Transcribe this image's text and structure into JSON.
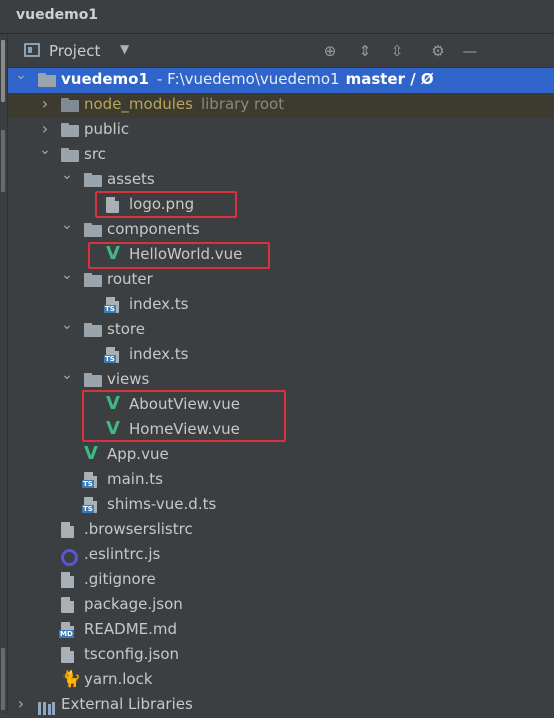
{
  "window": {
    "title": "vuedemo1"
  },
  "header": {
    "label": "Project"
  },
  "tree": [
    {
      "id": "root",
      "label": "vuedemo1",
      "sub": "- F:\\vuedemo\\vuedemo1",
      "vcs": "master / Ø",
      "kind": "folder",
      "arrow": "down",
      "depth": 0,
      "selected": true
    },
    {
      "id": "node-modules",
      "label": "node_modules",
      "sub": "library root",
      "kind": "folder-dim",
      "arrow": "right",
      "depth": 1,
      "excluded": true
    },
    {
      "id": "public",
      "label": "public",
      "kind": "folder",
      "arrow": "right",
      "depth": 1
    },
    {
      "id": "src",
      "label": "src",
      "kind": "folder",
      "arrow": "down",
      "depth": 1
    },
    {
      "id": "assets",
      "label": "assets",
      "kind": "folder",
      "arrow": "down",
      "depth": 2
    },
    {
      "id": "logo-png",
      "label": "logo.png",
      "kind": "image",
      "depth": 3
    },
    {
      "id": "components",
      "label": "components",
      "kind": "folder",
      "arrow": "down",
      "depth": 2
    },
    {
      "id": "helloworld-vue",
      "label": "HelloWorld.vue",
      "kind": "vue",
      "depth": 3
    },
    {
      "id": "router",
      "label": "router",
      "kind": "folder",
      "arrow": "down",
      "depth": 2
    },
    {
      "id": "router-index-ts",
      "label": "index.ts",
      "kind": "ts",
      "depth": 3
    },
    {
      "id": "store",
      "label": "store",
      "kind": "folder",
      "arrow": "down",
      "depth": 2
    },
    {
      "id": "store-index-ts",
      "label": "index.ts",
      "kind": "ts",
      "depth": 3
    },
    {
      "id": "views",
      "label": "views",
      "kind": "folder",
      "arrow": "down",
      "depth": 2
    },
    {
      "id": "aboutview-vue",
      "label": "AboutView.vue",
      "kind": "vue",
      "depth": 3
    },
    {
      "id": "homeview-vue",
      "label": "HomeView.vue",
      "kind": "vue",
      "depth": 3
    },
    {
      "id": "app-vue",
      "label": "App.vue",
      "kind": "vue",
      "depth": 2
    },
    {
      "id": "main-ts",
      "label": "main.ts",
      "kind": "ts",
      "depth": 2
    },
    {
      "id": "shims-vue-d-ts",
      "label": "shims-vue.d.ts",
      "kind": "ts",
      "depth": 2
    },
    {
      "id": "browserslistrc",
      "label": ".browserslistrc",
      "kind": "text",
      "depth": 1
    },
    {
      "id": "eslintrc-js",
      "label": ".eslintrc.js",
      "kind": "eslint",
      "depth": 1
    },
    {
      "id": "gitignore",
      "label": ".gitignore",
      "kind": "ignore",
      "depth": 1
    },
    {
      "id": "package-json",
      "label": "package.json",
      "kind": "json",
      "depth": 1
    },
    {
      "id": "readme-md",
      "label": "README.md",
      "kind": "md",
      "depth": 1
    },
    {
      "id": "tsconfig-json",
      "label": "tsconfig.json",
      "kind": "json",
      "depth": 1
    },
    {
      "id": "yarn-lock",
      "label": "yarn.lock",
      "kind": "yarn",
      "depth": 1
    },
    {
      "id": "external-libraries",
      "label": "External Libraries",
      "kind": "library",
      "arrow": "right",
      "depth": 0
    }
  ],
  "colors": {
    "selection": "#2f65ca",
    "highlight_box": "#d8323c",
    "vue_green": "#41b883"
  }
}
